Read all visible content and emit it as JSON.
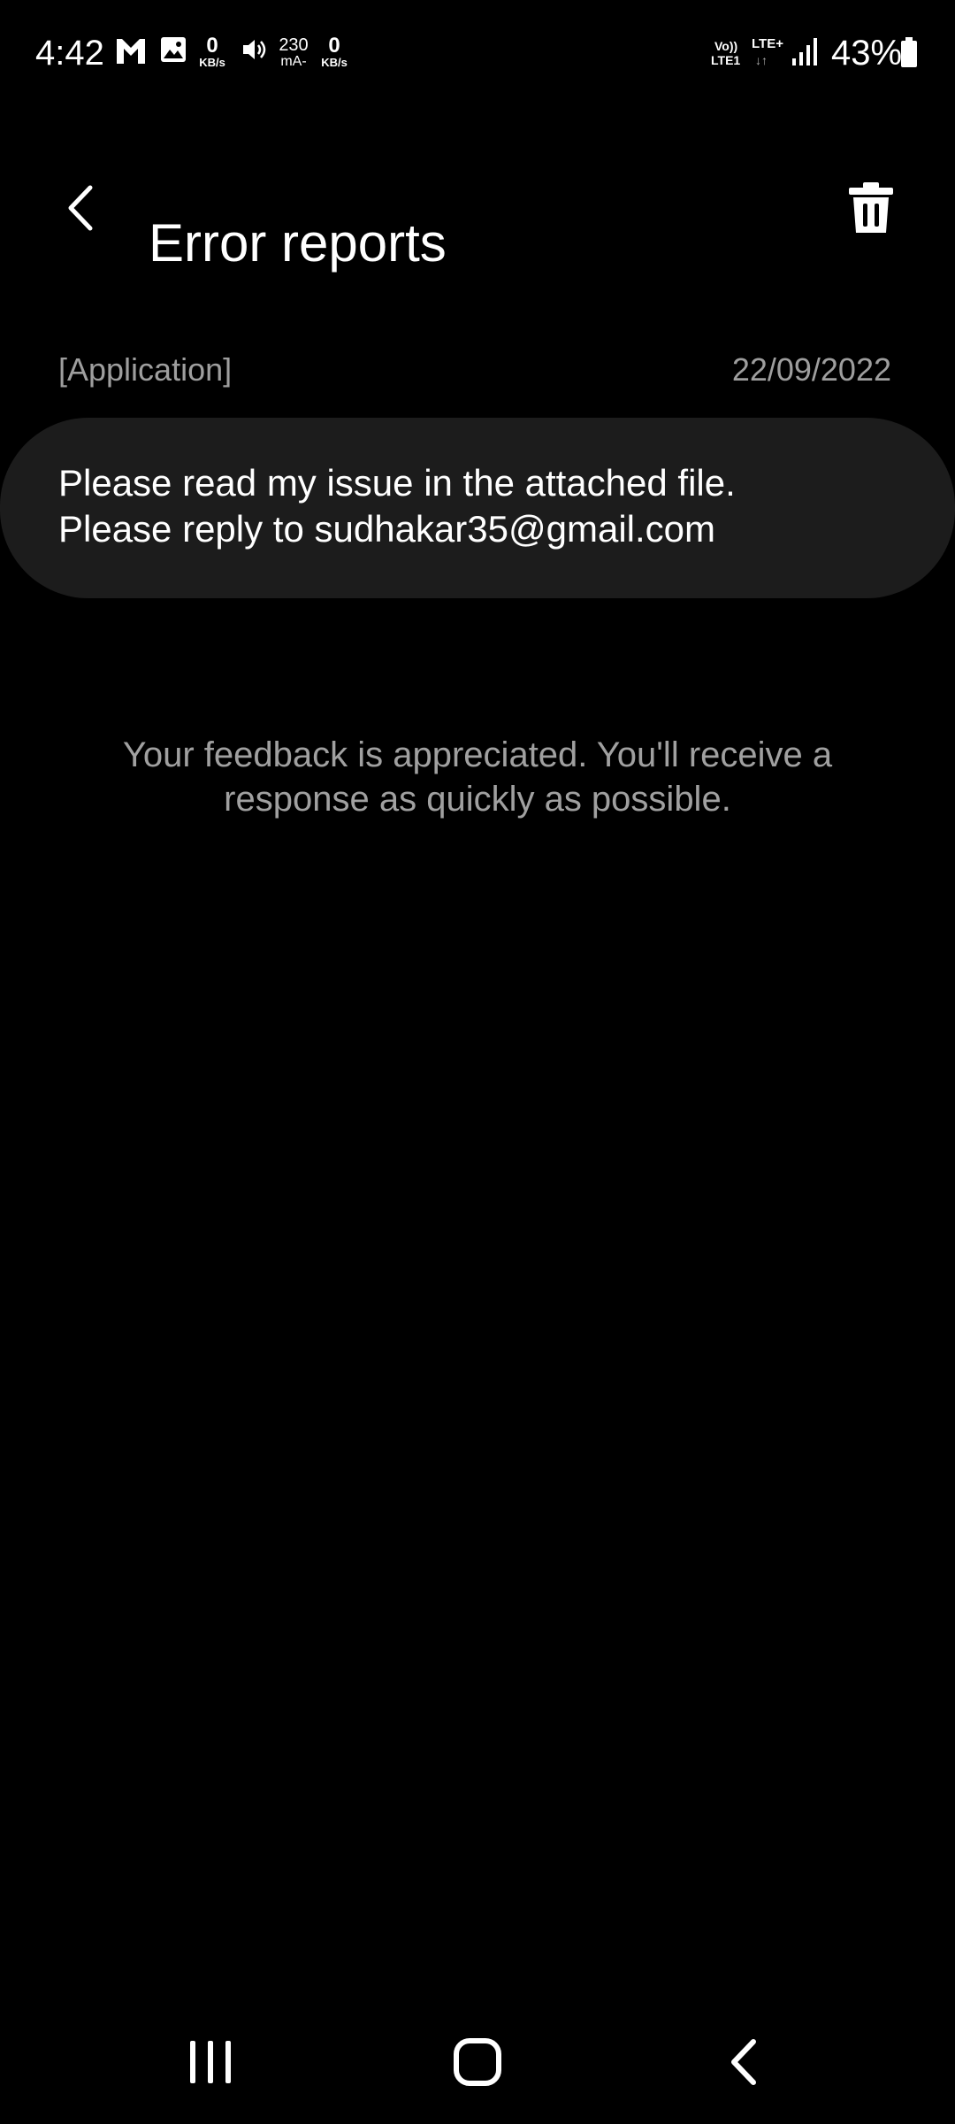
{
  "status_bar": {
    "time": "4:42",
    "speed_down": {
      "value": "0",
      "unit": "KB/s"
    },
    "current": {
      "value": "230",
      "unit": "mA-"
    },
    "speed_up": {
      "value": "0",
      "unit": "KB/s"
    },
    "network": {
      "volte": "Vo))",
      "sim": "LTE1",
      "type": "LTE+",
      "arrows": "↓↑"
    },
    "battery": "43%",
    "icons": [
      "gmail-icon",
      "gallery-icon",
      "volume-icon",
      "signal-icon",
      "battery-icon"
    ]
  },
  "header": {
    "title": "Error reports",
    "back_icon": "back-chevron-icon",
    "delete_icon": "trash-icon"
  },
  "report": {
    "category": "[Application]",
    "date": "22/09/2022",
    "message_lines": [
      "Please read my issue in the attached file.",
      "Please reply to sudhakar35@gmail.com"
    ]
  },
  "feedback_note": "Your feedback is appreciated. You'll receive a response as quickly as possible.",
  "nav_bar": {
    "icons": [
      "recents-icon",
      "home-icon",
      "back-icon"
    ]
  },
  "colors": {
    "background": "#000000",
    "card": "#1c1c1c",
    "primary_text": "#ffffff",
    "secondary_text": "#9e9e9e"
  }
}
